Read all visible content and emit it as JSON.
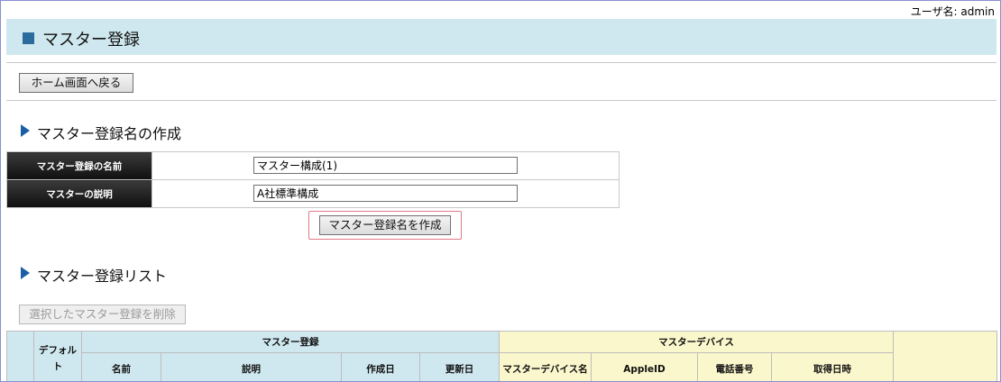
{
  "user": {
    "label": "ユーザ名:",
    "name": "admin"
  },
  "page_title": "マスター登録",
  "nav": {
    "home_button": "ホーム画面へ戻る"
  },
  "create_section": {
    "title": "マスター登録名の作成",
    "fields": [
      {
        "label": "マスター登録の名前",
        "value": "マスター構成(1)"
      },
      {
        "label": "マスターの説明",
        "value": "A社標準構成"
      }
    ],
    "create_button": "マスター登録名を作成"
  },
  "list_section": {
    "title": "マスター登録リスト",
    "delete_button": "選択したマスター登録を削除",
    "table": {
      "default_col": "デフォルト",
      "group_master": "マスター登録",
      "group_device": "マスターデバイス",
      "master_cols": [
        "名前",
        "説明",
        "作成日",
        "更新日"
      ],
      "device_cols": [
        "マスターデバイス名",
        "AppleID",
        "電話番号",
        "取得日時"
      ]
    }
  },
  "colors": {
    "title_bar": "#cfe8ef",
    "accent_square": "#2a6c9e",
    "section_triangle": "#1a5ea8",
    "highlight_border": "#e07a86",
    "device_header": "#fbf7cc"
  }
}
